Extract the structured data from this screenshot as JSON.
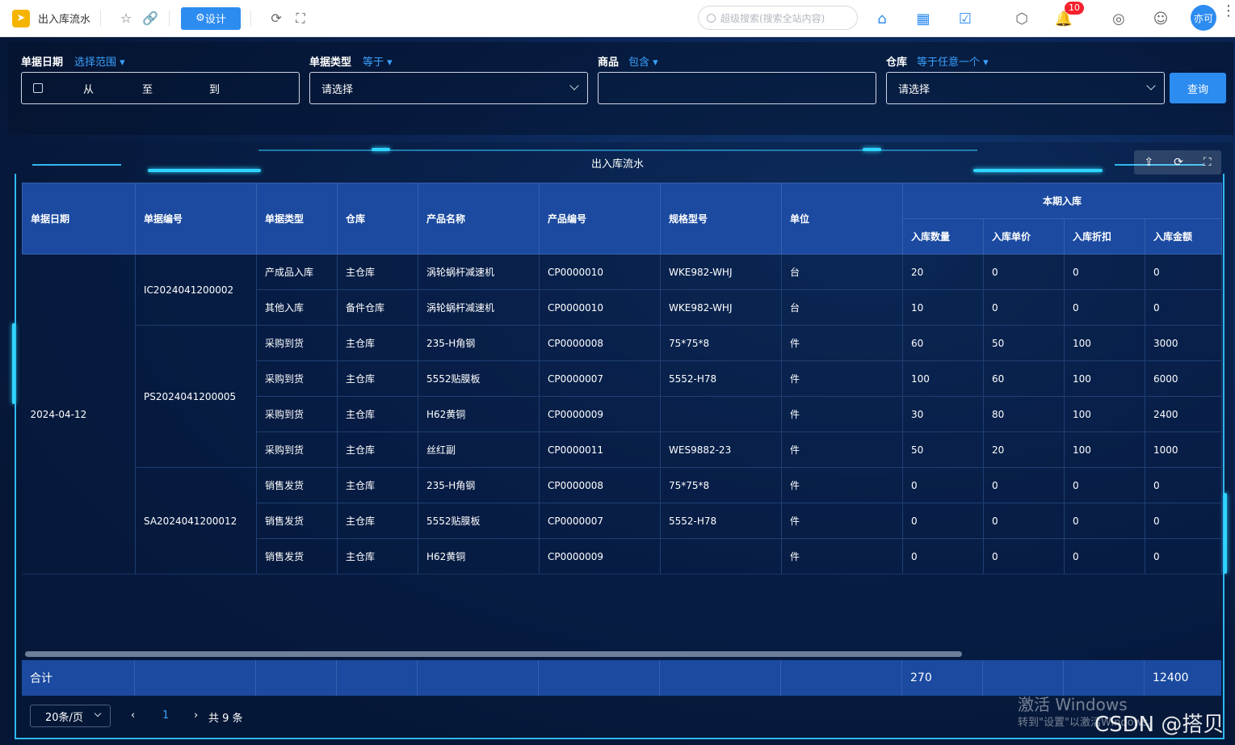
{
  "topbar": {
    "title": "出入库流水",
    "design_label": "设计",
    "search_placeholder": "超级搜索(搜索全站内容)",
    "notification_count": "10",
    "avatar_text": "亦可"
  },
  "filters": {
    "date": {
      "label": "单据日期",
      "op": "选择范围",
      "from": "从",
      "middle": "至",
      "to": "到"
    },
    "type": {
      "label": "单据类型",
      "op": "等于",
      "placeholder": "请选择"
    },
    "product": {
      "label": "商品",
      "op": "包含",
      "value": ""
    },
    "warehouse": {
      "label": "仓库",
      "op": "等于任意一个",
      "placeholder": "请选择"
    },
    "query_label": "查询"
  },
  "panel": {
    "title": "出入库流水"
  },
  "table": {
    "headers": [
      "单据日期",
      "单据编号",
      "单据类型",
      "仓库",
      "产品名称",
      "产品编号",
      "规格型号",
      "单位"
    ],
    "group_header": "本期入库",
    "sub_headers": [
      "入库数量",
      "入库单价",
      "入库折扣",
      "入库金额"
    ],
    "date_value": "2024-04-12",
    "doc_groups": [
      {
        "doc_no": "IC2024041200002",
        "rows": [
          [
            "产成品入库",
            "主仓库",
            "涡轮蜗杆减速机",
            "CP0000010",
            "WKE982-WHJ",
            "台",
            "20",
            "0",
            "0",
            "0"
          ],
          [
            "其他入库",
            "备件仓库",
            "涡轮蜗杆减速机",
            "CP0000010",
            "WKE982-WHJ",
            "台",
            "10",
            "0",
            "0",
            "0"
          ]
        ]
      },
      {
        "doc_no": "PS2024041200005",
        "rows": [
          [
            "采购到货",
            "主仓库",
            "235-H角钢",
            "CP0000008",
            "75*75*8",
            "件",
            "60",
            "50",
            "100",
            "3000"
          ],
          [
            "采购到货",
            "主仓库",
            "5552贴膜板",
            "CP0000007",
            "5552-H78",
            "件",
            "100",
            "60",
            "100",
            "6000"
          ],
          [
            "采购到货",
            "主仓库",
            "H62黄铜",
            "CP0000009",
            "",
            "件",
            "30",
            "80",
            "100",
            "2400"
          ],
          [
            "采购到货",
            "主仓库",
            "丝红副",
            "CP0000011",
            "WES9882-23",
            "件",
            "50",
            "20",
            "100",
            "1000"
          ]
        ]
      },
      {
        "doc_no": "SA2024041200012",
        "rows": [
          [
            "销售发货",
            "主仓库",
            "235-H角钢",
            "CP0000008",
            "75*75*8",
            "件",
            "0",
            "0",
            "0",
            "0"
          ],
          [
            "销售发货",
            "主仓库",
            "5552贴膜板",
            "CP0000007",
            "5552-H78",
            "件",
            "0",
            "0",
            "0",
            "0"
          ],
          [
            "销售发货",
            "主仓库",
            "H62黄铜",
            "CP0000009",
            "",
            "件",
            "0",
            "0",
            "0",
            "0"
          ]
        ]
      }
    ],
    "footer": {
      "label": "合计",
      "qty_total": "270",
      "amount_total": "12400"
    }
  },
  "pager": {
    "page_size": "20条/页",
    "current_page": "1",
    "total": "共 9 条"
  },
  "overlay": {
    "activate": "激活 Windows",
    "activate_hint": "转到\"设置\"以激活Windows。",
    "brand": "CSDN @搭贝"
  }
}
